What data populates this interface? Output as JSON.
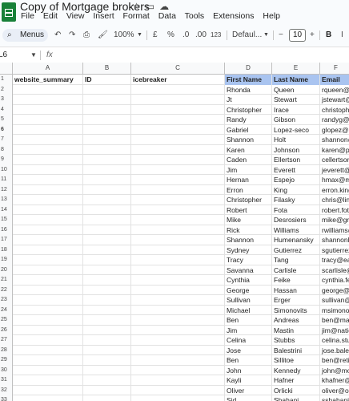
{
  "app": {
    "title": "Copy of Mortgage brokers",
    "menu": [
      "File",
      "Edit",
      "View",
      "Insert",
      "Format",
      "Data",
      "Tools",
      "Extensions",
      "Help"
    ]
  },
  "toolbar": {
    "menus_label": "Menus",
    "zoom": "100%",
    "currency": "£",
    "percent": "%",
    "dec_decrease": ".0",
    "dec_increase": ".00",
    "number_format": "123",
    "font": "Defaul...",
    "font_size": "10",
    "bold": "B"
  },
  "formula_bar": {
    "name_box": "L6",
    "fx": "fx"
  },
  "columns": [
    "A",
    "B",
    "C",
    "D",
    "E",
    "F"
  ],
  "header_row": {
    "a": "website_summary",
    "b": "ID",
    "c": "icebreaker",
    "d": "First Name",
    "e": "Last Name",
    "f": "Email"
  },
  "row_numbers": [
    "1",
    "2",
    "3",
    "4",
    "5",
    "6",
    "7",
    "8",
    "9",
    "10",
    "11",
    "12",
    "13",
    "14",
    "15",
    "16",
    "17",
    "18",
    "19",
    "20",
    "21",
    "22",
    "23",
    "24",
    "25",
    "26",
    "27",
    "28",
    "29",
    "30",
    "31",
    "32",
    "33"
  ],
  "rows": [
    {
      "first": "Rhonda",
      "last": "Queen",
      "email": "rqueen@"
    },
    {
      "first": "Jt",
      "last": "Stewart",
      "email": "jstewart@"
    },
    {
      "first": "Christopher",
      "last": "Irace",
      "email": "christophe"
    },
    {
      "first": "Randy",
      "last": "Gibson",
      "email": "randyg@"
    },
    {
      "first": "Gabriel",
      "last": "Lopez-seco",
      "email": "glopez@c"
    },
    {
      "first": "Shannon",
      "last": "Holt",
      "email": "shannon@"
    },
    {
      "first": "Karen",
      "last": "Johnson",
      "email": "karen@p"
    },
    {
      "first": "Caden",
      "last": "Ellertson",
      "email": "cellertson"
    },
    {
      "first": "Jim",
      "last": "Everett",
      "email": "jeverett@"
    },
    {
      "first": "Hernan",
      "last": "Espejo",
      "email": "hmax@m"
    },
    {
      "first": "Erron",
      "last": "King",
      "email": "erron.king"
    },
    {
      "first": "Christopher",
      "last": "Filasky",
      "email": "chris@lin"
    },
    {
      "first": "Robert",
      "last": "Fota",
      "email": "robert.fota"
    },
    {
      "first": "Mike",
      "last": "Desrosiers",
      "email": "mike@gro"
    },
    {
      "first": "Rick",
      "last": "Williams",
      "email": "rwilliams@"
    },
    {
      "first": "Shannon",
      "last": "Humenansky",
      "email": "shannonh"
    },
    {
      "first": "Sydney",
      "last": "Gutierrez",
      "email": "sgutierrez"
    },
    {
      "first": "Tracy",
      "last": "Tang",
      "email": "tracy@ea"
    },
    {
      "first": "Savanna",
      "last": "Carlisle",
      "email": "scarlisle@"
    },
    {
      "first": "Cynthia",
      "last": "Feike",
      "email": "cynthia.fe"
    },
    {
      "first": "George",
      "last": "Hassan",
      "email": "george@g"
    },
    {
      "first": "Sullivan",
      "last": "Erger",
      "email": "sullivan@"
    },
    {
      "first": "Michael",
      "last": "Simonovits",
      "email": "msimonov"
    },
    {
      "first": "Ben",
      "last": "Andreas",
      "email": "ben@mai"
    },
    {
      "first": "Jim",
      "last": "Mastin",
      "email": "jim@natio"
    },
    {
      "first": "Celina",
      "last": "Stubbs",
      "email": "celina.stu"
    },
    {
      "first": "Jose",
      "last": "Balestrini",
      "email": "jose.bales"
    },
    {
      "first": "Ben",
      "last": "Sillitoe",
      "email": "ben@retin"
    },
    {
      "first": "John",
      "last": "Kennedy",
      "email": "john@mo"
    },
    {
      "first": "Kayli",
      "last": "Hafner",
      "email": "khafner@"
    },
    {
      "first": "Oliver",
      "last": "Orlicki",
      "email": "oliver@or"
    },
    {
      "first": "Sid",
      "last": "Shahani",
      "email": "sshahani@"
    }
  ]
}
